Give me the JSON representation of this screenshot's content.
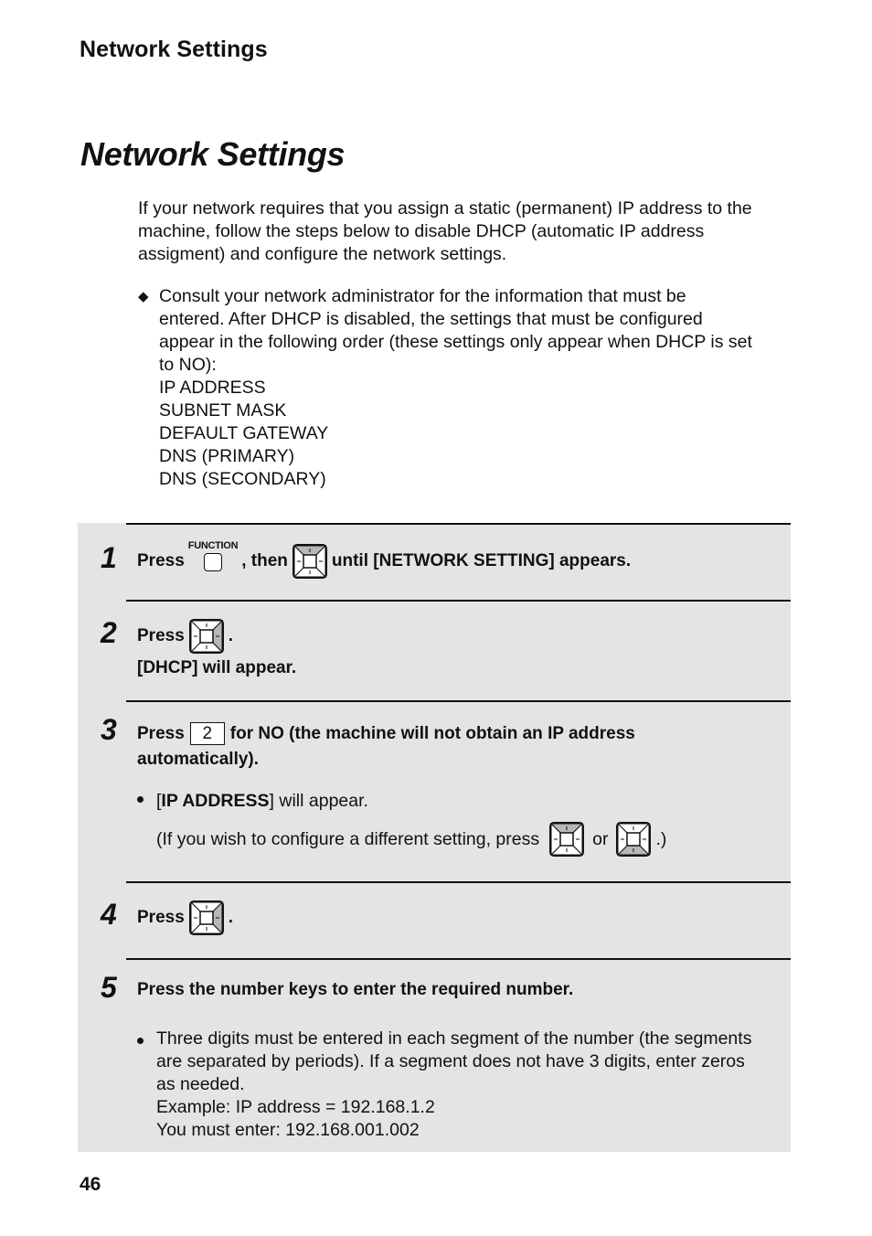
{
  "header": {
    "running_title": "Network Settings",
    "page_title": "Network Settings"
  },
  "intro": {
    "lines": [
      "If your network requires that you assign a static (permanent) IP address to the",
      "machine, follow the steps below to disable DHCP (automatic IP address",
      "assigment) and configure the network settings."
    ]
  },
  "note": {
    "bullet_icon": "diamond-bullet",
    "lines": [
      "Consult your network administrator for the information that must be",
      "entered. After DHCP is disabled, the settings that must be configured",
      "appear in the following order (these settings only appear when DHCP is set",
      "to NO):"
    ],
    "settings": [
      "IP ADDRESS",
      "SUBNET MASK",
      "DEFAULT GATEWAY",
      "DNS (PRIMARY)",
      "DNS (SECONDARY)"
    ]
  },
  "steps": [
    {
      "number": "1",
      "press": "Press",
      "function_key_label": "FUNCTION",
      "then": ", then",
      "rest": "until [NETWORK SETTING] appears.",
      "arrow_highlight": "up"
    },
    {
      "number": "2",
      "press": "Press",
      "period": ".",
      "line2": "[DHCP] will appear.",
      "arrow_highlight": "right"
    },
    {
      "number": "3",
      "press": "Press",
      "key": "2",
      "rest": "for NO (the machine will not obtain an IP address",
      "line2": "automatically).",
      "bullet_open": "[",
      "bullet_bold": "IP ADDRESS",
      "bullet_rest": "] will appear.",
      "paren_text": "(If you wish to configure a different setting, press",
      "or": "or",
      "paren_close": ".)",
      "arrow_highlights": [
        "up",
        "down"
      ]
    },
    {
      "number": "4",
      "press": "Press",
      "period": ".",
      "arrow_highlight": "right"
    },
    {
      "number": "5",
      "text": "Press the number keys to enter the required number.",
      "bullet_lines": [
        "Three digits must be entered in each segment of the number (the segments",
        "are separated by periods). If a segment does not have 3 digits, enter zeros",
        "as needed.",
        "Example: IP address = 192.168.1.2",
        "You must enter: 192.168.001.002"
      ]
    }
  ],
  "footer": {
    "page_number": "46"
  },
  "colors": {
    "panel_bg": "#e4e4e4",
    "key_highlight": "#b8b8b8",
    "text": "#111111"
  }
}
